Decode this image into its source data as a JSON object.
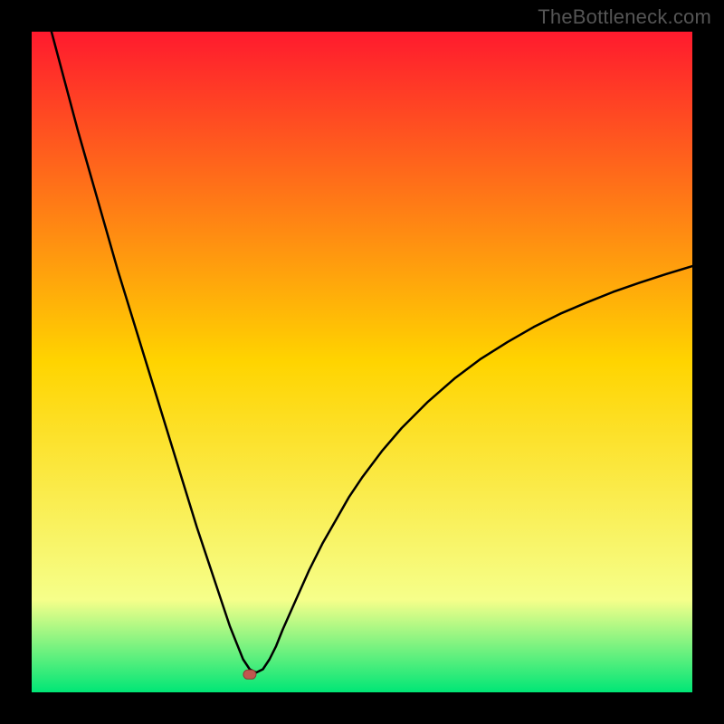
{
  "watermark": "TheBottleneck.com",
  "colors": {
    "frame": "#000000",
    "gradient_top": "#ff1a2e",
    "gradient_mid": "#ffd400",
    "gradient_band": "#f6ff8a",
    "gradient_bottom": "#00e676",
    "curve": "#000000",
    "marker_fill": "#c0574f",
    "marker_stroke": "#8e3c36"
  },
  "chart_data": {
    "type": "line",
    "title": "",
    "xlabel": "",
    "ylabel": "",
    "xlim": [
      0,
      100
    ],
    "ylim": [
      0,
      100
    ],
    "marker": {
      "x": 33,
      "y": 2.7
    },
    "series": [
      {
        "name": "bottleneck-curve",
        "x": [
          3,
          5,
          7,
          9,
          11,
          13,
          15,
          17,
          19,
          21,
          23,
          25,
          27,
          29,
          30,
          31,
          32,
          33,
          34,
          35,
          36,
          37,
          38,
          40,
          42,
          44,
          46,
          48,
          50,
          53,
          56,
          60,
          64,
          68,
          72,
          76,
          80,
          84,
          88,
          92,
          96,
          100
        ],
        "values": [
          100,
          92.5,
          85,
          78,
          71,
          64,
          57.5,
          51,
          44.5,
          38,
          31.5,
          25,
          19,
          13,
          10,
          7.5,
          5,
          3.5,
          3,
          3.5,
          5,
          7,
          9.5,
          14,
          18.5,
          22.5,
          26,
          29.5,
          32.5,
          36.5,
          40,
          44,
          47.5,
          50.5,
          53,
          55.3,
          57.3,
          59,
          60.6,
          62,
          63.3,
          64.5
        ]
      }
    ]
  }
}
